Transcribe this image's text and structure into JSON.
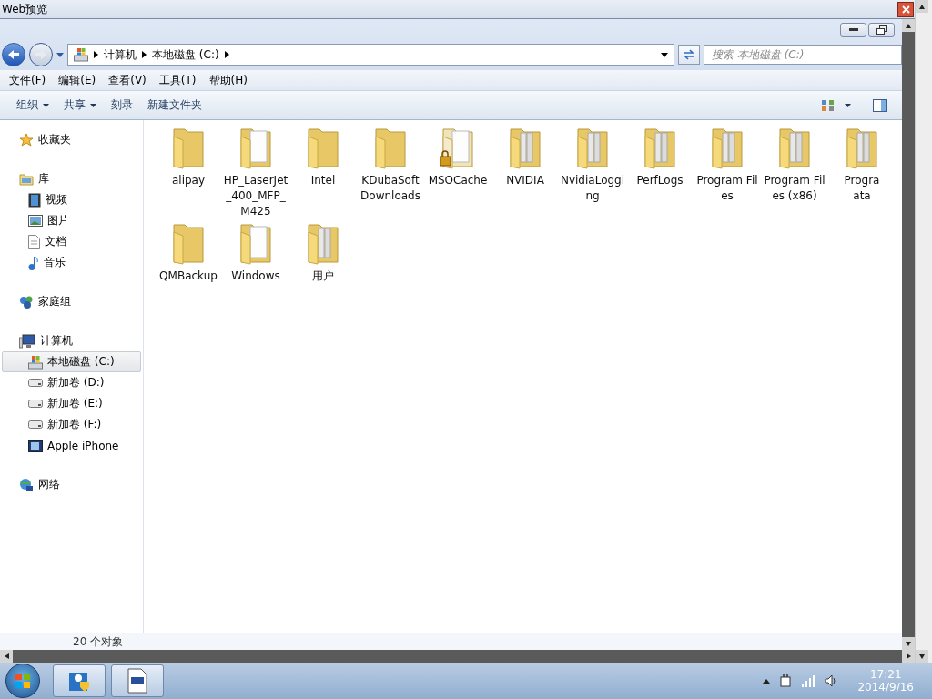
{
  "window": {
    "title": "Web预览"
  },
  "address": {
    "crumbs": [
      "计算机",
      "本地磁盘 (C:)"
    ],
    "search_placeholder": "搜索 本地磁盘 (C:)"
  },
  "menu": [
    "文件(F)",
    "编辑(E)",
    "查看(V)",
    "工具(T)",
    "帮助(H)"
  ],
  "toolbar": [
    {
      "label": "组织",
      "dropdown": true
    },
    {
      "label": "共享",
      "dropdown": true
    },
    {
      "label": "刻录",
      "dropdown": false
    },
    {
      "label": "新建文件夹",
      "dropdown": false
    }
  ],
  "sidebar": [
    {
      "label": "收藏夹"
    },
    {
      "label": "库",
      "children": [
        {
          "label": "视频",
          "selected": false
        },
        {
          "label": "图片",
          "selected": false
        },
        {
          "label": "文档",
          "selected": false
        },
        {
          "label": "音乐",
          "selected": false
        }
      ]
    },
    {
      "label": "家庭组"
    },
    {
      "label": "计算机",
      "children": [
        {
          "label": "本地磁盘 (C:)",
          "selected": true
        },
        {
          "label": "新加卷 (D:)",
          "selected": false
        },
        {
          "label": "新加卷 (E:)",
          "selected": false
        },
        {
          "label": "新加卷 (F:)",
          "selected": false
        },
        {
          "label": "Apple iPhone",
          "selected": false
        }
      ]
    },
    {
      "label": "网络"
    }
  ],
  "folders": [
    {
      "name": "alipay",
      "kind": "plain"
    },
    {
      "name": "HP_LaserJet_400_MFP_M425",
      "kind": "papers"
    },
    {
      "name": "Intel",
      "kind": "plain"
    },
    {
      "name": "KDubaSoftDownloads",
      "kind": "plain"
    },
    {
      "name": "MSOCache",
      "kind": "locked"
    },
    {
      "name": "NVIDIA",
      "kind": "files"
    },
    {
      "name": "NvidiaLogging",
      "kind": "files"
    },
    {
      "name": "PerfLogs",
      "kind": "files"
    },
    {
      "name": "Program Files",
      "kind": "files"
    },
    {
      "name": "Program Files (x86)",
      "kind": "files"
    },
    {
      "name": "Progra\nata",
      "kind": "files"
    },
    {
      "name": "QMBackup",
      "kind": "plain"
    },
    {
      "name": "Windows",
      "kind": "papers"
    },
    {
      "name": "用户",
      "kind": "files"
    }
  ],
  "status_bar": {
    "count": "20 个对象"
  },
  "taskbar": {
    "time": "17:21",
    "date": "2014/9/16"
  }
}
